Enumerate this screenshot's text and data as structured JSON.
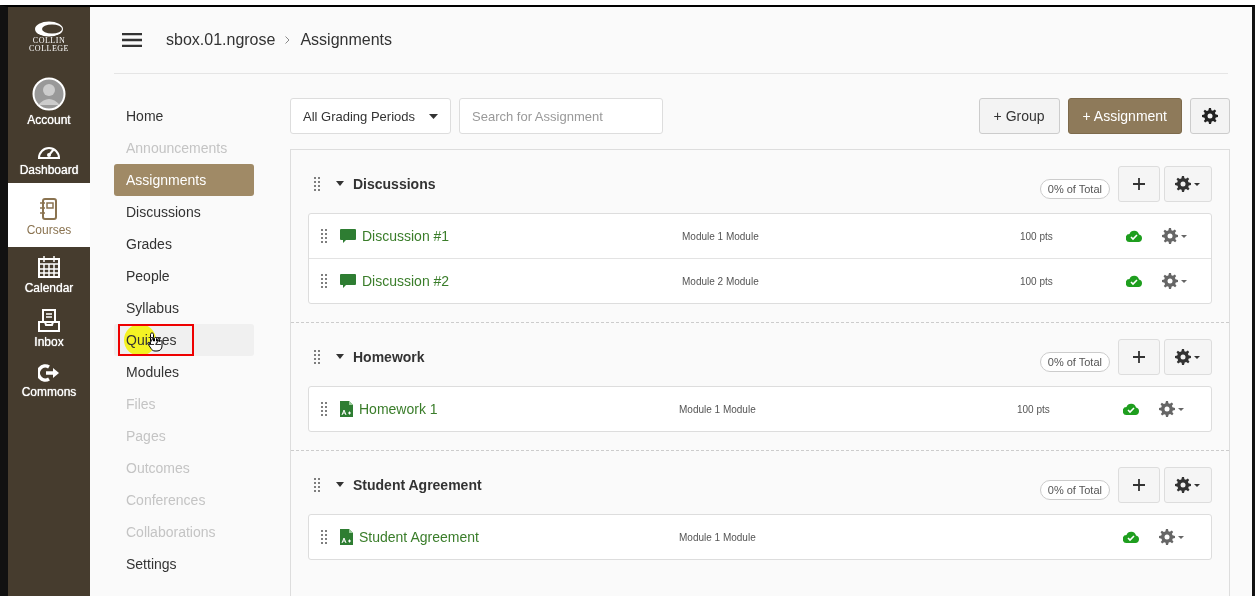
{
  "global_nav": {
    "logo": {
      "line1": "COLLIN",
      "line2": "COLLEGE"
    },
    "items": [
      {
        "label": "Account",
        "kind": "avatar",
        "selected": false
      },
      {
        "label": "Dashboard",
        "kind": "gauge",
        "selected": false
      },
      {
        "label": "Courses",
        "kind": "notebook",
        "selected": true
      },
      {
        "label": "Calendar",
        "kind": "calendar",
        "selected": false
      },
      {
        "label": "Inbox",
        "kind": "inbox",
        "selected": false
      },
      {
        "label": "Commons",
        "kind": "exit",
        "selected": false
      }
    ]
  },
  "breadcrumb": [
    {
      "label": "sbox.01.ngrose"
    },
    {
      "label": "Assignments"
    }
  ],
  "course_nav": [
    {
      "label": "Home",
      "selected": false,
      "disabled": false,
      "highlighted": false
    },
    {
      "label": "Announcements",
      "selected": false,
      "disabled": true,
      "highlighted": false
    },
    {
      "label": "Assignments",
      "selected": true,
      "disabled": false,
      "highlighted": false
    },
    {
      "label": "Discussions",
      "selected": false,
      "disabled": false,
      "highlighted": false
    },
    {
      "label": "Grades",
      "selected": false,
      "disabled": false,
      "highlighted": false
    },
    {
      "label": "People",
      "selected": false,
      "disabled": false,
      "highlighted": false
    },
    {
      "label": "Syllabus",
      "selected": false,
      "disabled": false,
      "highlighted": false
    },
    {
      "label": "Quizzes",
      "selected": false,
      "disabled": false,
      "highlighted": true
    },
    {
      "label": "Modules",
      "selected": false,
      "disabled": false,
      "highlighted": false
    },
    {
      "label": "Files",
      "selected": false,
      "disabled": true,
      "highlighted": false
    },
    {
      "label": "Pages",
      "selected": false,
      "disabled": true,
      "highlighted": false
    },
    {
      "label": "Outcomes",
      "selected": false,
      "disabled": true,
      "highlighted": false
    },
    {
      "label": "Conferences",
      "selected": false,
      "disabled": true,
      "highlighted": false
    },
    {
      "label": "Collaborations",
      "selected": false,
      "disabled": true,
      "highlighted": false
    },
    {
      "label": "Settings",
      "selected": false,
      "disabled": false,
      "highlighted": false
    }
  ],
  "toolbar": {
    "grading_period": "All Grading Periods",
    "search": {
      "placeholder": "Search for Assignment"
    },
    "buttons": [
      {
        "label": "+ Group",
        "kind": "default"
      },
      {
        "label": "+ Assignment",
        "kind": "primary"
      }
    ]
  },
  "groups": [
    {
      "name": "Discussions",
      "weight": "0% of Total",
      "expanded": true,
      "items": [
        {
          "kind": "discussion",
          "title": "Discussion #1",
          "module": "Module 1 Module",
          "points": "100 pts",
          "published": true
        },
        {
          "kind": "discussion",
          "title": "Discussion #2",
          "module": "Module 2 Module",
          "points": "100 pts",
          "published": true
        }
      ]
    },
    {
      "name": "Homework",
      "weight": "0% of Total",
      "expanded": true,
      "items": [
        {
          "kind": "assignment",
          "title": "Homework 1",
          "module": "Module 1 Module",
          "points": "100 pts",
          "published": true
        }
      ]
    },
    {
      "name": "Student Agreement",
      "weight": "0% of Total",
      "expanded": true,
      "items": [
        {
          "kind": "assignment",
          "title": "Student Agreement",
          "module": "Module 1 Module",
          "published": true
        }
      ]
    }
  ]
}
